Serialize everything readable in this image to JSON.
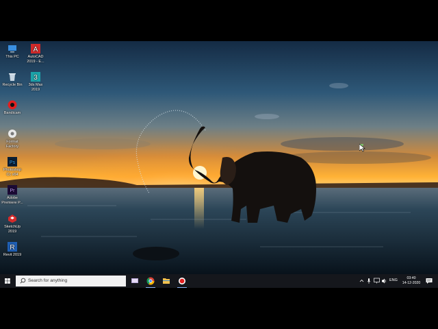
{
  "desktop": {
    "icons": [
      {
        "label": "This PC",
        "icon": "this-pc-icon"
      },
      {
        "label": "AutoCAD 2019 - E...",
        "icon": "autocad-icon"
      },
      {
        "label": "Recycle Bin",
        "icon": "recycle-bin-icon"
      },
      {
        "label": "3ds Max 2019",
        "icon": "3ds-max-icon"
      },
      {
        "label": "Bandicam",
        "icon": "bandicam-icon"
      },
      {
        "label": "Format Factory",
        "icon": "format-factory-icon"
      },
      {
        "label": "Photoshop Cc x64",
        "icon": "photoshop-icon"
      },
      {
        "label": "Adobe Premiere P...",
        "icon": "premiere-icon"
      },
      {
        "label": "SketchUp 2019",
        "icon": "sketchup-icon"
      },
      {
        "label": "Revit 2019",
        "icon": "revit-icon"
      }
    ]
  },
  "taskbar": {
    "search_placeholder": "Search for anything",
    "apps": [
      {
        "name": "task-view",
        "icon": "task-view-icon"
      },
      {
        "name": "chrome",
        "icon": "chrome-icon",
        "active": true
      },
      {
        "name": "file-explorer",
        "icon": "folder-icon"
      },
      {
        "name": "recorder",
        "icon": "record-icon",
        "active": true
      }
    ],
    "tray": {
      "language": "ENG",
      "time": "03:40",
      "date": "14-12-2020"
    }
  },
  "colors": {
    "taskbar": "#15171c",
    "search_box": "#f2f2f2",
    "sky_top": "#16304a",
    "horizon": "#ffb437"
  }
}
